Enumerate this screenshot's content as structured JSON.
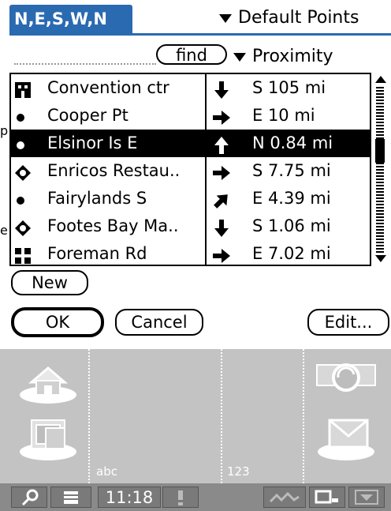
{
  "header": {
    "title": "N,E,S,W,N",
    "category": "Default Points",
    "colors": {
      "title_bg": "#2a6ab0"
    }
  },
  "search": {
    "find_label": "find",
    "sort_label": "Proximity"
  },
  "waypoints": [
    {
      "name": "Convention ctr",
      "icon": "building-icon",
      "direction": "S",
      "distance": "S 105 mi",
      "selected": false
    },
    {
      "name": "Cooper Pt",
      "icon": "dot-icon",
      "direction": "E",
      "distance": "E 10 mi",
      "selected": false
    },
    {
      "name": "Elsinor Is E",
      "icon": "dot-icon",
      "direction": "N",
      "distance": "N 0.84 mi",
      "selected": true
    },
    {
      "name": "Enricos Restau..",
      "icon": "diamond-icon",
      "direction": "E",
      "distance": "S 7.75 mi",
      "selected": false
    },
    {
      "name": "Fairylands S",
      "icon": "dot-icon",
      "direction": "NE",
      "distance": "E 4.39 mi",
      "selected": false
    },
    {
      "name": "Footes Bay Ma..",
      "icon": "diamond-icon",
      "direction": "S",
      "distance": "S 1.06 mi",
      "selected": false
    },
    {
      "name": "Foreman Rd",
      "icon": "intersection-icon",
      "direction": "E",
      "distance": "E 7.02 mi",
      "selected": false
    }
  ],
  "buttons": {
    "new": "New",
    "ok": "OK",
    "cancel": "Cancel",
    "edit": "Edit..."
  },
  "edge_fragments": {
    "left_a": "p",
    "left_b": "e"
  },
  "graffiti": {
    "abc_label": "abc",
    "num_label": "123"
  },
  "statusbar": {
    "time": "11:18"
  }
}
